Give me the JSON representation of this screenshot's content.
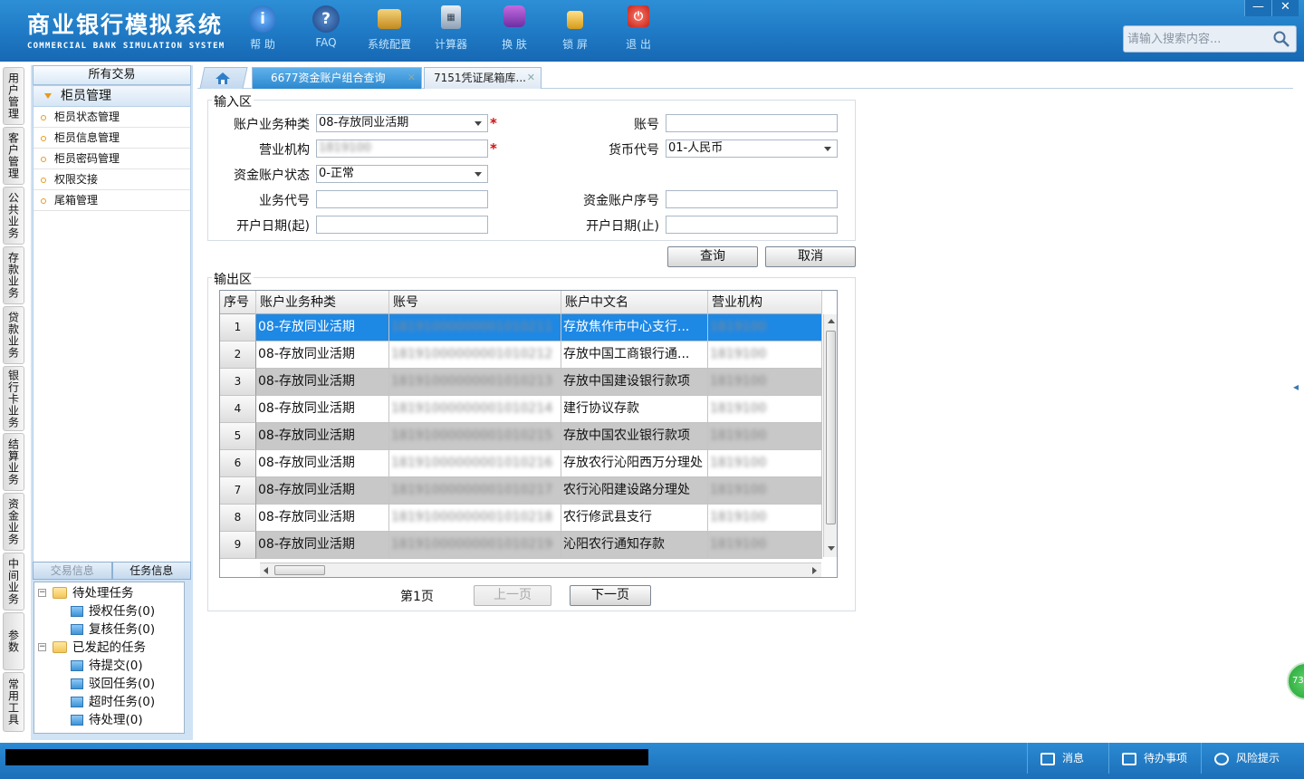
{
  "header": {
    "title_cn": "商业银行模拟系统",
    "title_en": "COMMERCIAL BANK SIMULATION SYSTEM",
    "toolbar": [
      {
        "label": "帮 助",
        "icon": "info-icon"
      },
      {
        "label": "FAQ",
        "icon": "question-icon"
      },
      {
        "label": "系统配置",
        "icon": "toolbox-icon"
      },
      {
        "label": "计算器",
        "icon": "calculator-icon"
      },
      {
        "label": "换 肤",
        "icon": "shirt-icon"
      },
      {
        "label": "锁 屏",
        "icon": "lock-icon"
      },
      {
        "label": "退 出",
        "icon": "power-icon"
      }
    ],
    "search_placeholder": "请输入搜索内容...",
    "window_controls": {
      "minimize": "—",
      "close": "✕"
    }
  },
  "vnav": [
    "用户管理",
    "客户管理",
    "公共业务",
    "存款业务",
    "贷款业务",
    "银行卡业务",
    "结算业务",
    "资金业务",
    "中间业务",
    "参数",
    "常用工具"
  ],
  "left_panel": {
    "title": "所有交易",
    "section": "柜员管理",
    "items": [
      "柜员状态管理",
      "柜员信息管理",
      "柜员密码管理",
      "权限交接",
      "尾箱管理"
    ],
    "tabs": {
      "transaction_info": "交易信息",
      "task_info": "任务信息"
    },
    "tree": {
      "pending": "待处理任务",
      "pending_children": [
        "授权任务(0)",
        "复核任务(0)"
      ],
      "initiated": "已发起的任务",
      "initiated_children": [
        "待提交(0)",
        "驳回任务(0)",
        "超时任务(0)",
        "待处理(0)"
      ]
    }
  },
  "tabs": [
    {
      "label": "6677资金账户组合查询",
      "active": true
    },
    {
      "label": "7151凭证尾箱库...",
      "active": false
    }
  ],
  "input_area": {
    "legend": "输入区",
    "account_type_label": "账户业务种类",
    "account_type_value": "08-存放同业活期",
    "account_no_label": "账号",
    "account_no_value": "",
    "org_label": "营业机构",
    "org_value": "1819100",
    "currency_label": "货币代号",
    "currency_value": "01-人民币",
    "status_label": "资金账户状态",
    "status_value": "0-正常",
    "biz_code_label": "业务代号",
    "biz_code_value": "",
    "seq_label": "资金账户序号",
    "seq_value": "",
    "open_start_label": "开户日期(起)",
    "open_start_value": "",
    "open_end_label": "开户日期(止)",
    "open_end_value": "",
    "query_button": "查询",
    "cancel_button": "取消"
  },
  "output_area": {
    "legend": "输出区",
    "columns": [
      "序号",
      "账户业务种类",
      "账号",
      "账户中文名",
      "营业机构"
    ],
    "rows": [
      {
        "no": "1",
        "type": "08-存放同业活期",
        "account": "18191000000001010211",
        "name": "存放焦作市中心支行...",
        "org": "1819100"
      },
      {
        "no": "2",
        "type": "08-存放同业活期",
        "account": "18191000000001010212",
        "name": "存放中国工商银行通...",
        "org": "1819100"
      },
      {
        "no": "3",
        "type": "08-存放同业活期",
        "account": "18191000000001010213",
        "name": "存放中国建设银行款项",
        "org": "1819100"
      },
      {
        "no": "4",
        "type": "08-存放同业活期",
        "account": "18191000000001010214",
        "name": "建行协议存款",
        "org": "1819100"
      },
      {
        "no": "5",
        "type": "08-存放同业活期",
        "account": "18191000000001010215",
        "name": "存放中国农业银行款项",
        "org": "1819100"
      },
      {
        "no": "6",
        "type": "08-存放同业活期",
        "account": "18191000000001010216",
        "name": "存放农行沁阳西万分理处",
        "org": "1819100"
      },
      {
        "no": "7",
        "type": "08-存放同业活期",
        "account": "18191000000001010217",
        "name": "农行沁阳建设路分理处",
        "org": "1819100"
      },
      {
        "no": "8",
        "type": "08-存放同业活期",
        "account": "18191000000001010218",
        "name": "农行修武县支行",
        "org": "1819100"
      },
      {
        "no": "9",
        "type": "08-存放同业活期",
        "account": "18191000000001010219",
        "name": "沁阳农行通知存款",
        "org": "1819100"
      }
    ],
    "page_label": "第1页",
    "prev_button": "上一页",
    "next_button": "下一页"
  },
  "bottom_bar": {
    "messages": "消息",
    "todo": "待办事项",
    "risk": "风险提示",
    "badge": "73"
  }
}
